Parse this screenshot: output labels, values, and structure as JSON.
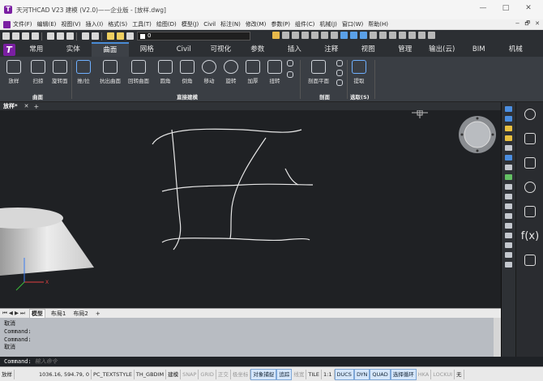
{
  "title_bar": {
    "text": "天河THCAD V23 建模 (V2.0)——企业版 - [放样.dwg]",
    "min": "—",
    "max": "□",
    "close": "✕"
  },
  "menu": {
    "items": [
      "文件(F)",
      "编辑(E)",
      "视图(V)",
      "插入(I)",
      "格式(S)",
      "工具(T)",
      "绘图(D)",
      "模型(J)",
      "Civil",
      "标注(N)",
      "修改(M)",
      "参数(P)",
      "组件(C)",
      "机械(J)",
      "窗口(W)",
      "帮助(H)"
    ],
    "right": [
      "−",
      "🗗",
      "✕"
    ]
  },
  "quick_access": {
    "layer_value": "0"
  },
  "ribbon": {
    "logo": "T",
    "tabs": [
      "常用",
      "实体",
      "曲面",
      "网格",
      "Civil",
      "可视化",
      "参数",
      "插入",
      "注释",
      "视图",
      "管理",
      "输出(云)",
      "BIM",
      "机械"
    ],
    "active_tab": "曲面",
    "buttons": {
      "loft": "放样",
      "sweep": "扫掠",
      "revolve": "旋转面",
      "extrude": "推/拉",
      "extrude_surf": "抗出曲面",
      "revolve_surf": "回转曲面",
      "section": "圆角",
      "chamfer": "倒角",
      "move": "移动",
      "rotate": "旋转",
      "thicken": "加厚",
      "twist": "扭转",
      "section_plane": "剖面平面",
      "pick": "提取"
    },
    "groups": {
      "surface": "曲面",
      "direct_model": "直接建模",
      "section": "剖面",
      "select": "选取(S)"
    }
  },
  "doc_tabs": {
    "active": "放样*",
    "close": "✕",
    "plus": "+"
  },
  "layout_tabs": {
    "nav": "⏮ ◀ ▶ ⏭",
    "tabs": [
      "模型",
      "布局1",
      "布局2"
    ],
    "active": "模型",
    "plus": "+"
  },
  "command": {
    "history": [
      "取消",
      "Command:",
      "Command:",
      "取消"
    ],
    "prompt_label": "Command:",
    "placeholder": "输入命令"
  },
  "status_bar": {
    "model_label": "放样",
    "coords": "1036.16, 594.79, 0",
    "items": [
      {
        "t": "PC_TEXTSTYLE",
        "s": "norm"
      },
      {
        "t": "TH_GBDIM",
        "s": "norm"
      },
      {
        "t": "建模",
        "s": "norm"
      },
      {
        "t": "SNAP",
        "s": "off"
      },
      {
        "t": "GRID",
        "s": "off"
      },
      {
        "t": "正交",
        "s": "off"
      },
      {
        "t": "极坐标",
        "s": "off"
      },
      {
        "t": "对象捕捉",
        "s": "on"
      },
      {
        "t": "追踪",
        "s": "on"
      },
      {
        "t": "线宽",
        "s": "off"
      },
      {
        "t": "TILE",
        "s": "norm"
      },
      {
        "t": "1:1",
        "s": "norm"
      },
      {
        "t": "DUCS",
        "s": "on"
      },
      {
        "t": "DYN",
        "s": "on"
      },
      {
        "t": "QUAD",
        "s": "on"
      },
      {
        "t": "选择循环",
        "s": "on"
      },
      {
        "t": "HKA",
        "s": "off"
      },
      {
        "t": "LOCKUI",
        "s": "off"
      },
      {
        "t": "无",
        "s": "norm"
      }
    ]
  },
  "right_panel": {
    "icons": [
      "lightbulb-icon",
      "sliders-icon",
      "layers-icon",
      "clip-icon",
      "hatch-icon",
      "function-icon",
      "hierarchy-icon"
    ],
    "fx": "f(x)"
  }
}
